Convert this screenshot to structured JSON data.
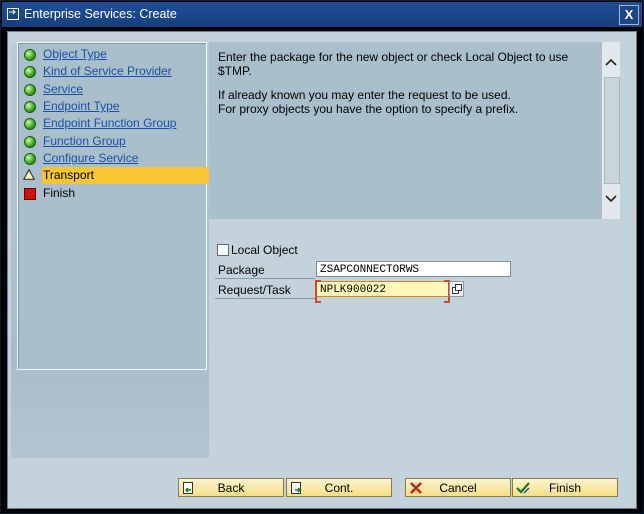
{
  "window": {
    "title": "Enterprise Services: Create",
    "close_label": "X"
  },
  "steps": [
    {
      "label": "Object Type",
      "status": "done"
    },
    {
      "label": "Kind of Service Provider",
      "status": "done"
    },
    {
      "label": "Service",
      "status": "done"
    },
    {
      "label": "Endpoint Type",
      "status": "done"
    },
    {
      "label": "Endpoint Function Group",
      "status": "done"
    },
    {
      "label": "Function Group",
      "status": "done"
    },
    {
      "label": "Configure Service",
      "status": "done"
    },
    {
      "label": "Transport",
      "status": "current"
    },
    {
      "label": "Finish",
      "status": "pending"
    }
  ],
  "info": {
    "text1": "Enter the package for the new object or check Local Object to use $TMP.",
    "text2": "If already known you may enter the request to be used.",
    "text3": "For proxy objects you have the option to specify a prefix."
  },
  "form": {
    "local_object_label": "Local Object",
    "local_object_checked": false,
    "package_label": "Package",
    "package_value": "ZSAPCONNECTORWS",
    "request_label": "Request/Task",
    "request_value": "NPLK900022"
  },
  "buttons": {
    "back": "Back",
    "cont": "Cont.",
    "cancel": "Cancel",
    "finish": "Finish"
  },
  "colors": {
    "titlebar": "#1b4585",
    "active_step": "#f8c632",
    "panel": "#a9bfcc",
    "link": "#1a4fa8"
  }
}
